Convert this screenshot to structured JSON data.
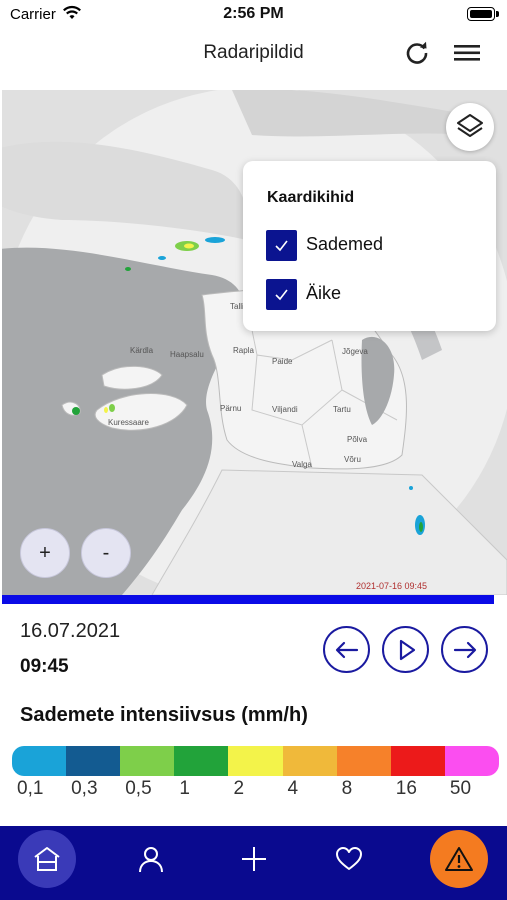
{
  "status_bar": {
    "carrier": "Carrier",
    "time": "2:56 PM"
  },
  "header": {
    "title": "Radaripildid",
    "refresh_icon": "refresh-icon",
    "menu_icon": "hamburger-menu-icon"
  },
  "map": {
    "timestamp": "2021-07-16 09:45",
    "cities": [
      "Tallinn",
      "Kärdla",
      "Haapsalu",
      "Rapla",
      "Paide",
      "Jõgeva",
      "Pärnu",
      "Viljandi",
      "Tartu",
      "Põlva",
      "Kuressaare",
      "Valga",
      "Võru"
    ],
    "zoom_in_label": "+",
    "zoom_out_label": "-",
    "layers_icon": "layers-icon"
  },
  "layers_panel": {
    "title": "Kaardikihid",
    "items": [
      {
        "label": "Sademed",
        "checked": true
      },
      {
        "label": "Äike",
        "checked": true
      }
    ]
  },
  "playback": {
    "date": "16.07.2021",
    "time": "09:45",
    "prev_icon": "arrow-left-icon",
    "play_icon": "play-icon",
    "next_icon": "arrow-right-icon"
  },
  "legend": {
    "title": "Sademete intensiivsus (mm/h)",
    "labels": [
      "0,1",
      "0,3",
      "0,5",
      "1",
      "2",
      "4",
      "8",
      "16",
      "50"
    ],
    "colors": [
      "#1aa3d8",
      "#135b91",
      "#7ecf4a",
      "#22a33a",
      "#f3f34a",
      "#f0b93a",
      "#f6812a",
      "#ec1a1a",
      "#fb4ef0"
    ]
  },
  "bottom_nav": {
    "items": [
      "home-icon",
      "profile-icon",
      "add-icon",
      "heart-icon",
      "warning-icon"
    ],
    "colors": {
      "background": "#0a0a8f",
      "warning": "#f47b20",
      "active": "#3a3ab8"
    }
  }
}
